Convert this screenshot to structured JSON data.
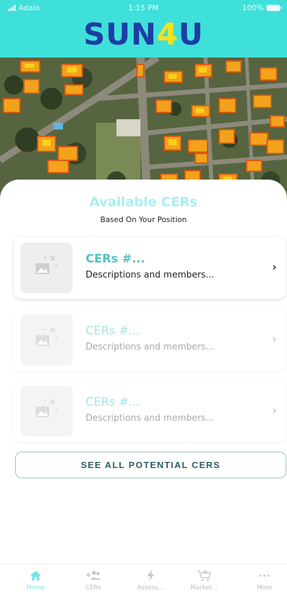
{
  "status_bar": {
    "carrier": "Adalo",
    "time": "1:15 PM",
    "battery": "100%"
  },
  "header": {
    "logo_part1": "SUN",
    "logo_part2": "4",
    "logo_part3": "U"
  },
  "panel": {
    "title": "Available CERs",
    "subtitle": "Based On Your Position"
  },
  "cers": [
    {
      "title": "CERs #...",
      "description": "Descriptions and members..."
    },
    {
      "title": "CERs #...",
      "description": "Descriptions and members..."
    },
    {
      "title": "CERs #...",
      "description": "Descriptions and members..."
    }
  ],
  "see_all_label": "SEE ALL POTENTIAL CERS",
  "nav": {
    "items": [
      {
        "label": "Home",
        "icon": "home-icon"
      },
      {
        "label": "CERs",
        "icon": "users-add-icon"
      },
      {
        "label": "Assess...",
        "icon": "lightning-icon"
      },
      {
        "label": "Market...",
        "icon": "cart-add-icon"
      },
      {
        "label": "More",
        "icon": "more-icon"
      }
    ]
  },
  "colors": {
    "header_bg": "#3fe0da",
    "logo": "#1c3ea4",
    "logo_accent": "#f5e11a",
    "accent": "#52c2c2",
    "active_nav": "#78e3ec"
  }
}
